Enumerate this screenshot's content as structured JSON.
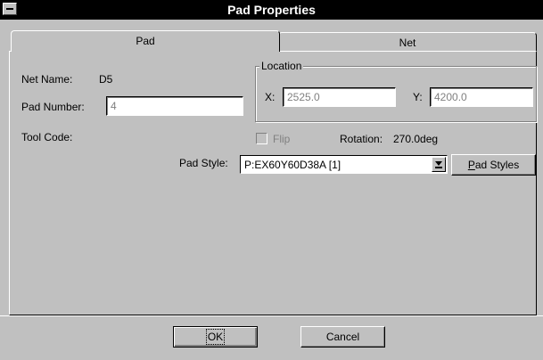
{
  "window": {
    "title": "Pad Properties"
  },
  "tabs": [
    {
      "label": "Pad",
      "active": true
    },
    {
      "label": "Net",
      "active": false
    }
  ],
  "pad": {
    "net_name_label": "Net Name:",
    "net_name_value": "D5",
    "pad_number_label": "Pad Number:",
    "pad_number_value": "4",
    "tool_code_label": "Tool Code:",
    "location": {
      "legend": "Location",
      "x_label": "X:",
      "x_value": "2525.0",
      "y_label": "Y:",
      "y_value": "4200.0"
    },
    "flip_label": "Flip",
    "flip_checked": false,
    "rotation_label": "Rotation:",
    "rotation_value": "270.0deg",
    "pad_style_label": "Pad Style:",
    "pad_style_value": "P:EX60Y60D38A [1]",
    "pad_styles_button": {
      "prefix": "P",
      "rest": "ad Styles"
    }
  },
  "footer": {
    "ok_label": "OK",
    "cancel_label": "Cancel"
  },
  "icons": [
    "control-menu-icon",
    "dropdown-arrow-icon"
  ]
}
